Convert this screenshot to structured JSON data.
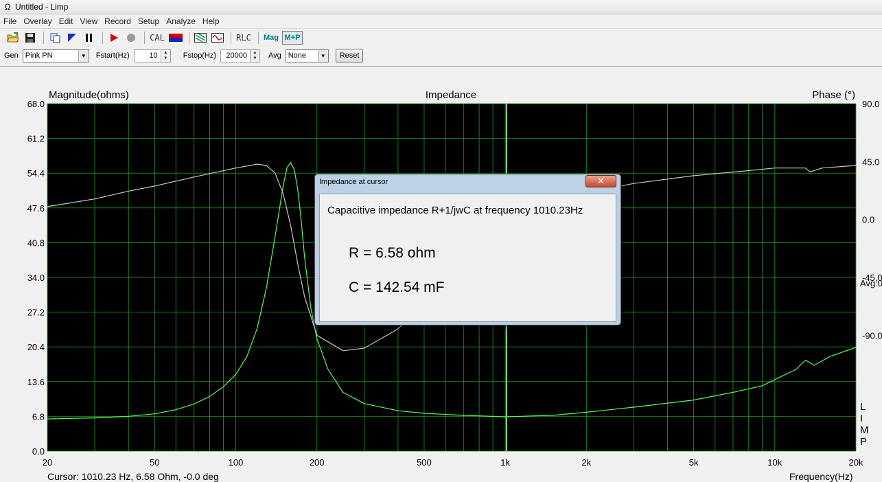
{
  "window": {
    "title": "Untitled - Limp",
    "app_icon": "Ω"
  },
  "menu": [
    "File",
    "Overlay",
    "Edit",
    "View",
    "Record",
    "Setup",
    "Analyze",
    "Help"
  ],
  "toolbar": {
    "icons": [
      "open-folder-icon",
      "save-icon",
      "copy-icon",
      "marker-icon",
      "pause-icon",
      "play-icon",
      "stop-icon"
    ],
    "cal_label": "CAL",
    "rlc_label": "RLC",
    "mag_label": "Mag",
    "mp_label": "M+P"
  },
  "controls": {
    "gen_label": "Gen",
    "gen_value": "Pink PN",
    "fstart_label": "Fstart(Hz)",
    "fstart_value": "10",
    "fstop_label": "Fstop(Hz)",
    "fstop_value": "20000",
    "avg_label": "Avg",
    "avg_value": "None",
    "reset_label": "Reset"
  },
  "dialog": {
    "title": "Impedance at cursor",
    "line1": "Capacitive impedance R+1/jwC at frequency 1010.23Hz",
    "r_text": "R = 6.58 ohm",
    "c_text": "C = 142.54 mF",
    "close_symbol": "✕"
  },
  "status": {
    "cursor_text": "Cursor: 1010.23 Hz, 6.58 Ohm, -0.0 deg",
    "freq_label": "Frequency(Hz)"
  },
  "chart_data": {
    "type": "line",
    "title": "Impedance",
    "ylabel": "Magnitude(ohms)",
    "y2label": "Phase (°)",
    "xlabel": "Frequency(Hz)",
    "x_scale": "log",
    "xlim": [
      20,
      20000
    ],
    "ylim": [
      0,
      68
    ],
    "y2lim": [
      -180,
      90
    ],
    "x_ticks": [
      {
        "v": 20,
        "label": "20"
      },
      {
        "v": 50,
        "label": "50"
      },
      {
        "v": 100,
        "label": "100"
      },
      {
        "v": 200,
        "label": "200"
      },
      {
        "v": 500,
        "label": "500"
      },
      {
        "v": 1000,
        "label": "1k"
      },
      {
        "v": 2000,
        "label": "2k"
      },
      {
        "v": 5000,
        "label": "5k"
      },
      {
        "v": 10000,
        "label": "10k"
      },
      {
        "v": 20000,
        "label": "20k"
      }
    ],
    "y_ticks": [
      "0.0",
      "6.8",
      "13.6",
      "20.4",
      "27.2",
      "34.0",
      "40.8",
      "47.6",
      "54.4",
      "61.2",
      "68.0"
    ],
    "y2_ticks": [
      {
        "v": 90,
        "label": "90.0"
      },
      {
        "v": 45,
        "label": "45.0"
      },
      {
        "v": 0,
        "label": "0.0"
      },
      {
        "v": -45,
        "label": "-45.0"
      },
      {
        "v": -90,
        "label": "-90.0"
      }
    ],
    "avg_label": "Avg:0",
    "side_label": [
      "L",
      "I",
      "M",
      "P"
    ],
    "cursor_x": 1010.23,
    "grid": true,
    "colors": {
      "background": "#000000",
      "grid": "#1f9a1f",
      "magnitude": "#55ff55",
      "phase": "#c8c8c8",
      "cursor": "#8ad88a"
    },
    "series": [
      {
        "name": "Magnitude",
        "axis": "left",
        "x": [
          20,
          30,
          40,
          50,
          60,
          70,
          80,
          90,
          100,
          110,
          120,
          130,
          140,
          150,
          155,
          160,
          165,
          170,
          175,
          180,
          190,
          200,
          220,
          250,
          300,
          400,
          500,
          700,
          1000,
          1500,
          2000,
          3000,
          5000,
          7000,
          9000,
          10000,
          12000,
          13000,
          14000,
          16000,
          20000
        ],
        "y": [
          6.3,
          6.5,
          6.8,
          7.3,
          8.1,
          9.2,
          10.7,
          12.6,
          15.0,
          18.5,
          24.0,
          32.0,
          42.0,
          52.0,
          55.5,
          56.5,
          55.0,
          51.0,
          45.0,
          38.0,
          28.0,
          22.0,
          16.0,
          11.5,
          9.3,
          7.9,
          7.4,
          7.0,
          6.7,
          7.0,
          7.6,
          8.6,
          10.0,
          11.5,
          12.8,
          14.0,
          16.0,
          17.8,
          16.8,
          18.5,
          20.3
        ]
      },
      {
        "name": "Phase",
        "axis": "right",
        "x": [
          20,
          30,
          40,
          50,
          70,
          100,
          120,
          130,
          140,
          150,
          160,
          170,
          180,
          200,
          250,
          300,
          400,
          500,
          700,
          1000,
          1500,
          2000,
          3000,
          5000,
          8000,
          10000,
          12000,
          13000,
          13500,
          15000,
          20000
        ],
        "y": [
          10,
          16,
          22,
          26,
          33,
          40,
          43,
          42,
          36,
          20,
          -5,
          -35,
          -60,
          -90,
          -102,
          -100,
          -85,
          -65,
          -30,
          2,
          15,
          21,
          28,
          34,
          38,
          40,
          40,
          40,
          37,
          40,
          42
        ]
      }
    ]
  }
}
